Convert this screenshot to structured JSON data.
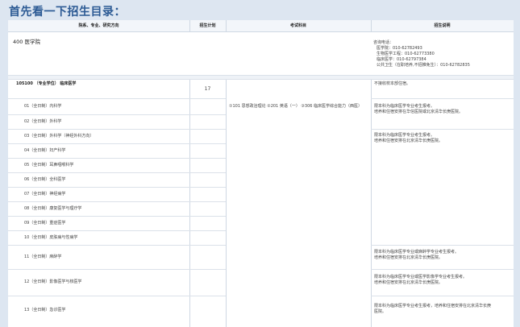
{
  "title": "首先看一下招生目录：",
  "table": {
    "headers": [
      "院系、专业、研究方向",
      "招生计划",
      "考试科目",
      "招生说明"
    ],
    "department": {
      "name": "400 医学院",
      "contact_lines": [
        "咨询电话：",
        "医学院：010-62782493",
        "生物医学工程：010-62773380",
        "临床医学：010-62797384",
        "公共卫生（在职培养,不招推免生）：010-62782835"
      ]
    },
    "program": {
      "code_name": "105100 （专业学位） 临床医学",
      "plan": "17",
      "note": "不接收校本部住宿。",
      "exam": "①101 思想政治理论 ②201 英语（一） ③306 临床医学综合能力（西医）"
    },
    "directions": [
      "01（全日制）内科学",
      "02（全日制）外科学",
      "03（全日制）外科学（神经外科方向）",
      "04（全日制）妇产科学",
      "05（全日制）耳鼻咽喉科学",
      "06（全日制）全科医学",
      "07（全日制）神经病学",
      "08（全日制）康复医学与理疗学",
      "09（全日制）重症医学",
      "10（全日制）皮肤病与性病学",
      "11（全日制）麻醉学",
      "12（全日制）影像医学与核医学",
      "13（全日制）急诊医学"
    ],
    "notes": {
      "n1": [
        "限本科为临床医学专业考生报考。",
        "培养和住宿安排在华信医院或北京清华长庚医院。"
      ],
      "n2": [
        "限本科为临床医学专业考生报考。",
        "培养和住宿安排在北京清华长庚医院。"
      ],
      "n3": [
        "限本科为临床医学专业或麻醉学专业考生报考。",
        "培养和住宿安排在北京清华长庚医院。"
      ],
      "n4": [
        "限本科为临床医学专业或医学影像学专业考生报考。",
        "培养和住宿安排在北京清华长庚医院。"
      ],
      "n5": [
        "限本科为临床医学专业考生报考，培养和住宿安排在北京清华长庚",
        "医院。"
      ]
    }
  }
}
